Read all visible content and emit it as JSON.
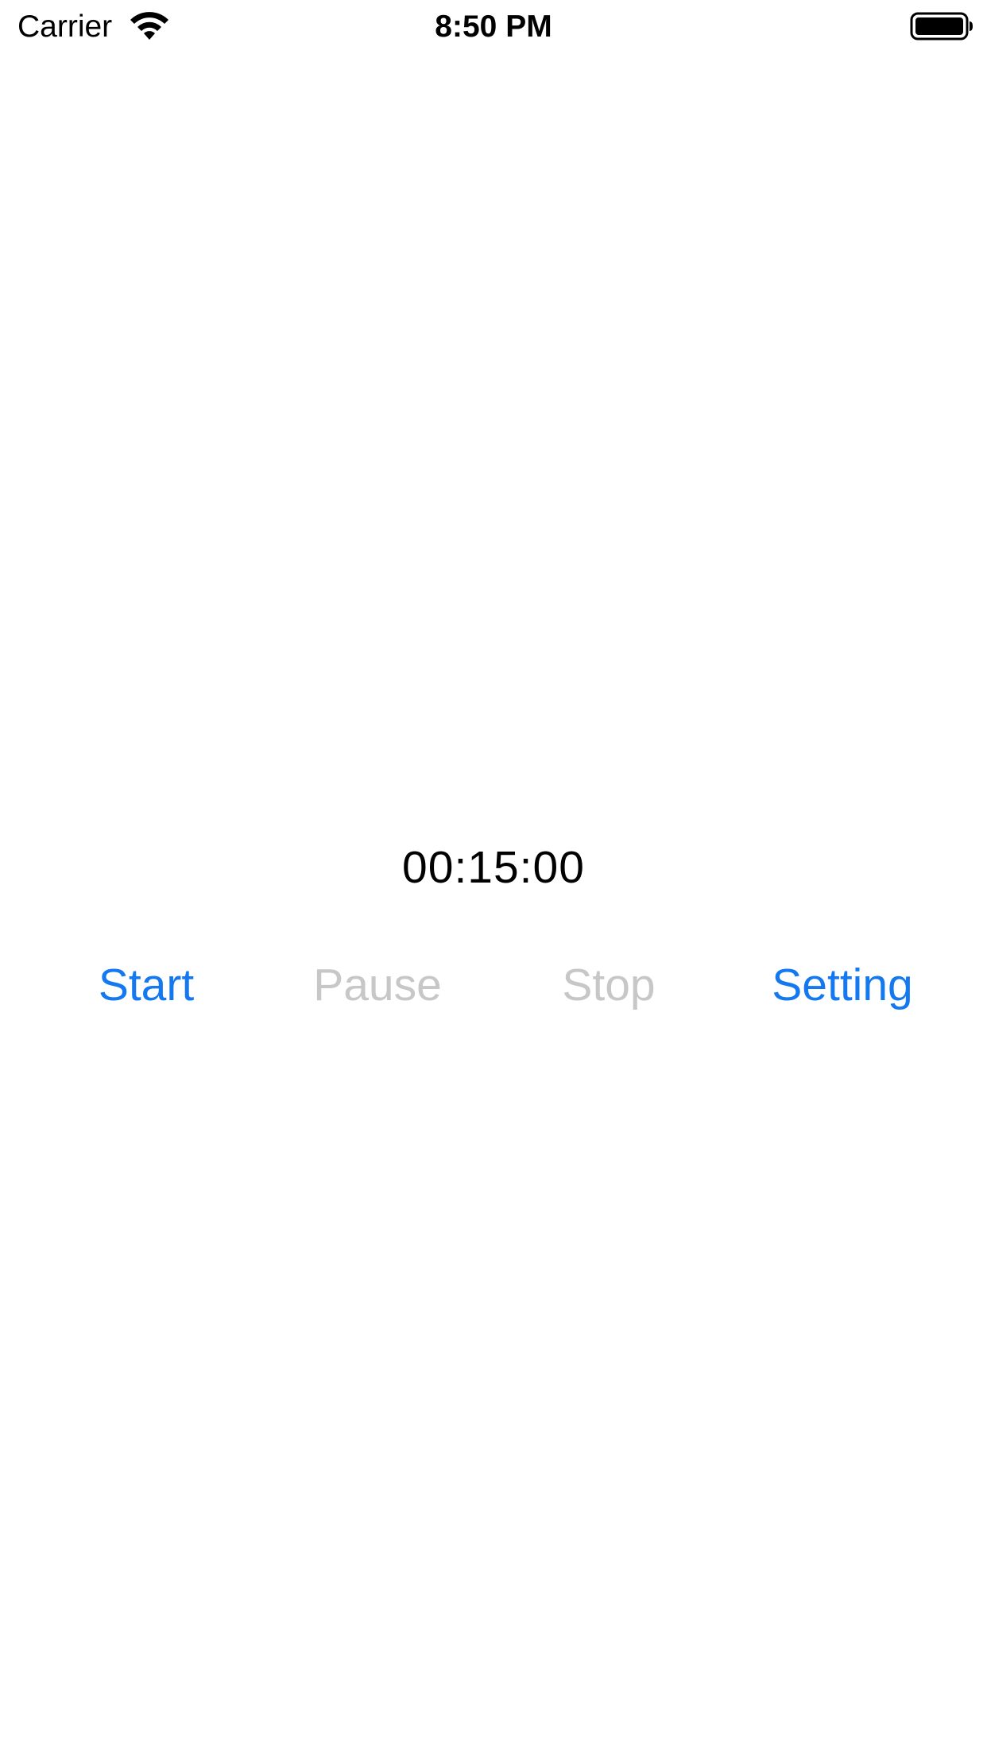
{
  "status_bar": {
    "carrier": "Carrier",
    "time": "8:50 PM",
    "wifi_icon": "wifi-icon",
    "battery_icon": "battery-full-icon"
  },
  "timer": {
    "display": "00:15:00"
  },
  "controls": {
    "start": {
      "label": "Start",
      "enabled": true
    },
    "pause": {
      "label": "Pause",
      "enabled": false
    },
    "stop": {
      "label": "Stop",
      "enabled": false
    },
    "setting": {
      "label": "Setting",
      "enabled": true
    }
  },
  "colors": {
    "accent": "#1479f1",
    "disabled": "#c7c7c7",
    "text": "#000000",
    "background": "#ffffff"
  }
}
